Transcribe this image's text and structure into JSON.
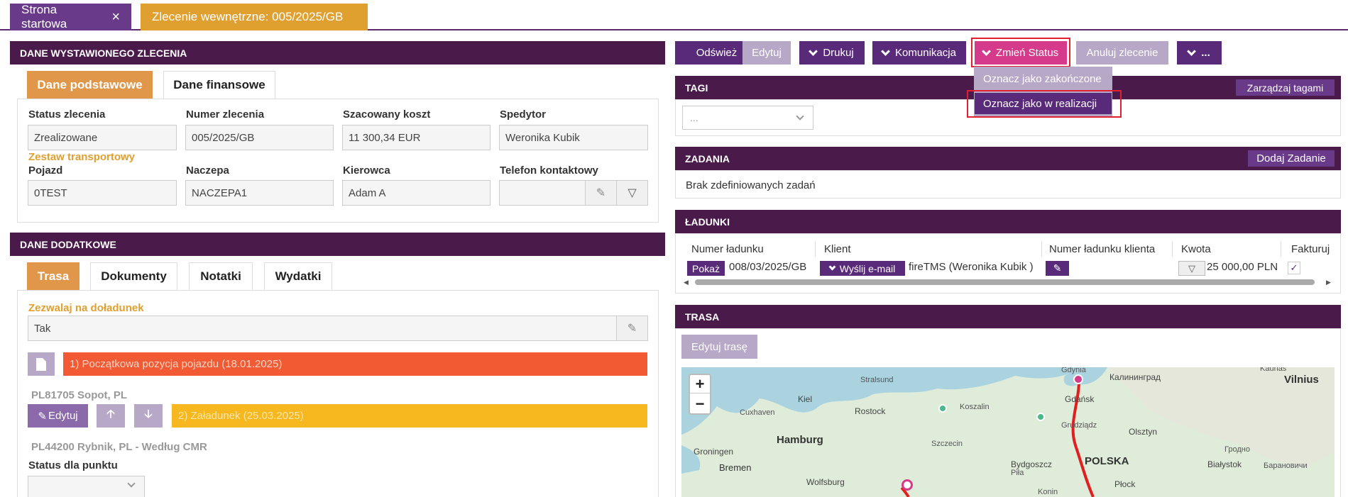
{
  "tabs": [
    {
      "label": "Strona startowa"
    },
    {
      "label": "Zlecenie wewnętrzne: 005/2025/GB"
    }
  ],
  "order_panel": {
    "title": "DANE WYSTAWIONEGO ZLECENIA",
    "subtabs": [
      "Dane podstawowe",
      "Dane finansowe"
    ],
    "labels": {
      "status": "Status zlecenia",
      "number": "Numer zlecenia",
      "cost": "Szacowany koszt",
      "forwarder": "Spedytor",
      "set": "Zestaw transportowy",
      "vehicle": "Pojazd",
      "trailer": "Naczepa",
      "driver": "Kierowca",
      "phone": "Telefon kontaktowy"
    },
    "values": {
      "status": "Zrealizowane",
      "number": "005/2025/GB",
      "cost": "11 300,34 EUR",
      "forwarder": "Weronika Kubik",
      "vehicle": "0TEST",
      "trailer": "NACZEPA1",
      "driver": "Adam A",
      "phone": ""
    }
  },
  "extra_panel": {
    "title": "DANE DODATKOWE",
    "subtabs": [
      "Trasa",
      "Dokumenty",
      "Notatki",
      "Wydatki"
    ],
    "reload_label": "Zezwalaj na doładunek",
    "reload_value": "Tak",
    "stop1": "1) Początkowa pozycja pojazdu (18.01.2025)",
    "stop1_addr": "PL81705 Sopot, PL",
    "edit_label": "Edytuj",
    "stop2": "2) Załadunek (25.03.2025)",
    "stop2_addr": "PL44200 Rybnik, PL - Według CMR",
    "point_status_label": "Status dla punktu"
  },
  "toolbar": {
    "refresh": "Odśwież",
    "edit": "Edytuj",
    "print": "Drukuj",
    "comm": "Komunikacja",
    "change_status": "Zmień Status",
    "cancel": "Anuluj zlecenie",
    "more": "..."
  },
  "status_menu": [
    "Oznacz jako zakończone",
    "Oznacz jako w realizacji"
  ],
  "tags": {
    "title": "TAGI",
    "manage": "Zarządzaj tagami",
    "select": "..."
  },
  "tasks": {
    "title": "ZADANIA",
    "add": "Dodaj Zadanie",
    "empty": "Brak zdefiniowanych zadań"
  },
  "loads": {
    "title": "ŁADUNKI",
    "columns": [
      "Numer ładunku",
      "Klient",
      "Numer ładunku klienta",
      "Kwota",
      "Fakturuj"
    ],
    "show": "Pokaż",
    "number": "008/03/2025/GB",
    "send_email": "Wyślij e-mail",
    "client": "fireTMS (Weronika Kubik )",
    "amount": "25 000,00 PLN"
  },
  "route": {
    "title": "TRASA",
    "edit": "Edytuj trasę"
  },
  "map": {
    "zoom_in": "+",
    "zoom_out": "−",
    "labels": [
      "Stralsund",
      "Gdynia",
      "Калининград",
      "Kaunas",
      "Vilnius",
      "Kiel",
      "Gdańsk",
      "Rostock",
      "Koszalin",
      "Grudziądz",
      "Olsztyn",
      "Cuxhaven",
      "Hamburg",
      "Szczecin",
      "Bydgoszcz",
      "POLSKA",
      "Гродно",
      "Groningen",
      "Bremen",
      "Piła",
      "Białystok",
      "Барановичи",
      "Wolfsburg",
      "Płock",
      "Konin"
    ]
  },
  "colors": {
    "purple_dark": "#4a1a4a",
    "purple": "#6a3a8a",
    "orange": "#e0974a",
    "pink": "#d63a8a",
    "stop1": "#f15a32",
    "stop2": "#f6b81e"
  }
}
